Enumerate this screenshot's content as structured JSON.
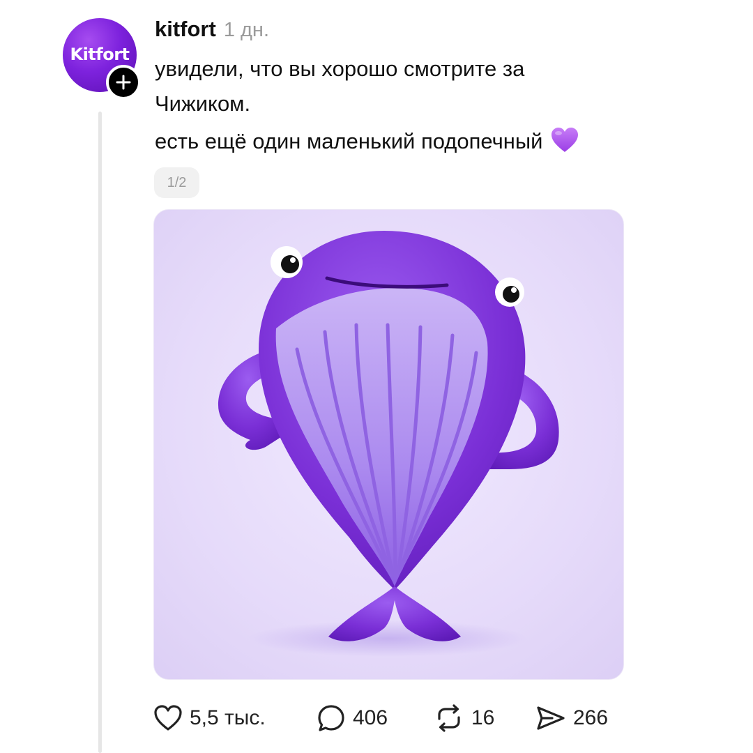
{
  "author": {
    "avatar_text": "Kitfort",
    "username": "kitfort",
    "timestamp": "1 дн."
  },
  "post": {
    "lines": [
      "увидели, что вы хорошо смотрите за",
      "Чижиком.",
      "есть ещё один маленький подопечный"
    ],
    "emoji": "purple-heart"
  },
  "media": {
    "pager": "1/2",
    "subject": "purple-whale-mascot"
  },
  "actions": {
    "likes": "5,5 тыс.",
    "comments": "406",
    "reposts": "16",
    "shares": "266"
  },
  "icons": {
    "like": "heart-icon",
    "comment": "comment-bubble-icon",
    "repost": "repost-icon",
    "share": "send-icon",
    "follow": "plus-icon"
  },
  "colors": {
    "brand_purple": "#7d22dd",
    "emoji_purple": "#b65cf0",
    "whale_body": "#7a2fd6",
    "whale_belly": "#b79bf1",
    "media_bg": "#e6dbfa",
    "thread_line": "#e6e6e6",
    "muted_text": "#9a9a9a"
  }
}
